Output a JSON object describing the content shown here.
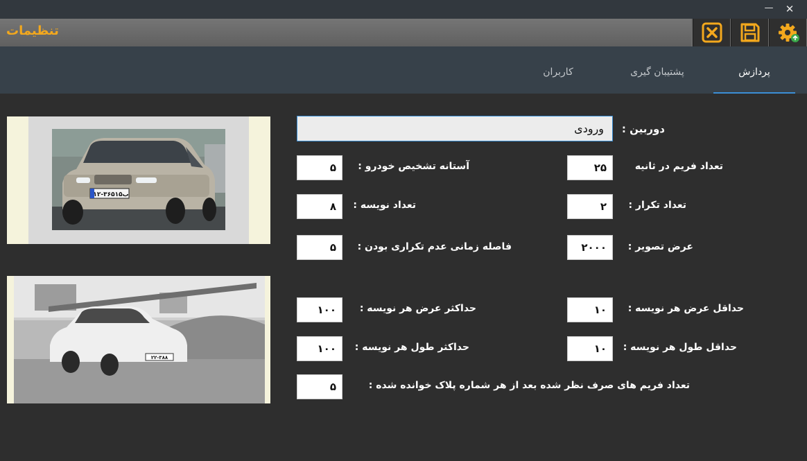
{
  "window": {
    "minimize_glyph": "—",
    "close_glyph": "✕"
  },
  "toolbar": {
    "title": "تنظیمات",
    "buttons": [
      {
        "icon": "close-x-icon",
        "color": "#f3a81d"
      },
      {
        "icon": "save-icon",
        "color": "#f3a81d"
      },
      {
        "icon": "gear-icon",
        "color": "#f3a81d"
      }
    ]
  },
  "tabs": [
    {
      "label": "پردازش",
      "active": true
    },
    {
      "label": "پشتیبان گیری",
      "active": false
    },
    {
      "label": "کاربران",
      "active": false
    }
  ],
  "form": {
    "camera_label": "دوربین :",
    "camera_value": "ورودی",
    "fps_label": "تعداد فریم در ثانیه",
    "fps_value": "۲۵",
    "detect_threshold_label": "آستانه تشخیص خودرو :",
    "detect_threshold_value": "۵",
    "repeat_count_label": "تعداد تکرار :",
    "repeat_count_value": "۲",
    "char_count_label": "تعداد نویسه :",
    "char_count_value": "۸",
    "image_width_label": "عرض تصویر :",
    "image_width_value": "۲۰۰۰",
    "non_repeat_interval_label": "فاصله زمانی عدم تکراری بودن :",
    "non_repeat_interval_value": "۵",
    "min_char_width_label": "حداقل عرض هر نویسه :",
    "min_char_width_value": "۱۰",
    "max_char_width_label": "حداکثر عرض هر نویسه :",
    "max_char_width_value": "۱۰۰",
    "min_char_height_label": "حداقل طول هر نویسه :",
    "min_char_height_value": "۱۰",
    "max_char_height_label": "حداکثر طول هر نویسه :",
    "max_char_height_value": "۱۰۰",
    "skipped_frames_label": "تعداد فریم های صرف نظر شده بعد از هر شماره پلاک خوانده شده :",
    "skipped_frames_value": "۵"
  },
  "images": {
    "top_plate_text": "۱۲-۳۶۵ب۱۵",
    "bottom_plate_text": "۲۲-۳۸۸"
  },
  "colors": {
    "accent": "#f3a81d",
    "tab_underline": "#3b8fd6",
    "background": "#2e2e2e"
  }
}
